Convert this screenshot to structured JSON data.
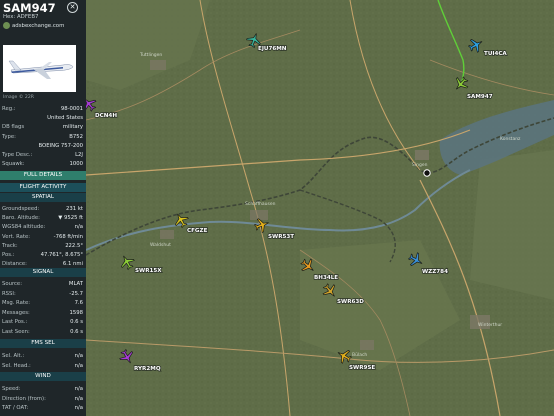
{
  "aircraft": {
    "callsign": "SAM947",
    "hex_line": "Hex:  ADFEB7",
    "source": "adsbexchange.com",
    "photo_credit": "Image © 22R",
    "fields": [
      {
        "label": "Reg.:",
        "value": "98-0001"
      },
      {
        "label": "",
        "value": "United States"
      },
      {
        "label": "DB flags",
        "value": "military"
      },
      {
        "label": "Type:",
        "value": "B752"
      },
      {
        "label": "",
        "value": "BOEING 757-200"
      },
      {
        "label": "Type Desc.:",
        "value": "L2J"
      },
      {
        "label": "Squawk:",
        "value": "1000"
      }
    ],
    "full_details": "FULL DETAILS",
    "flight_activity": "FLIGHT ACTIVITY",
    "spatial_header": "SPATIAL",
    "spatial": [
      {
        "label": "Groundspeed:",
        "value": "231 kt"
      },
      {
        "label": "Baro. Altitude:",
        "value": "▼ 9525 ft"
      },
      {
        "label": "WGS84 altitude:",
        "value": "n/a"
      },
      {
        "label": "Vert. Rate:",
        "value": "-768 ft/min"
      },
      {
        "label": "Track:",
        "value": "222.5°"
      },
      {
        "label": "Pos.:",
        "value": "47.761°, 8.675°"
      },
      {
        "label": "Distance:",
        "value": "6.1 nmi"
      }
    ],
    "signal_header": "SIGNAL",
    "signal": [
      {
        "label": "Source:",
        "value": "MLAT"
      },
      {
        "label": "RSSI:",
        "value": "-25.7"
      },
      {
        "label": "Msg. Rate:",
        "value": "7.6"
      },
      {
        "label": "Messages:",
        "value": "1598"
      },
      {
        "label": "Last Pos.:",
        "value": "0.6 s"
      },
      {
        "label": "Last Seen:",
        "value": "0.6 s"
      }
    ],
    "fms_header": "FMS SEL",
    "fms": [
      {
        "label": "Sel. Alt.:",
        "value": "n/a"
      },
      {
        "label": "Sel. Head.:",
        "value": "n/a"
      }
    ],
    "wind_header": "WIND",
    "wind": [
      {
        "label": "Speed:",
        "value": "n/a"
      },
      {
        "label": "Direction (from):",
        "value": "n/a"
      },
      {
        "label": "TAT / OAT:",
        "value": "n/a"
      }
    ]
  },
  "map": {
    "planes": [
      {
        "label": "EJU76MN",
        "color": "#37b39a"
      },
      {
        "label": "TUI4CA",
        "color": "#2ea0e0"
      },
      {
        "label": "SAM947",
        "color": "#8dcc38"
      },
      {
        "label": "DCN4H",
        "color": "#a63cd6"
      },
      {
        "label": "CFGZE",
        "color": "#d8c21c"
      },
      {
        "label": "SWR53T",
        "color": "#e3b01b"
      },
      {
        "label": "WZZ784",
        "color": "#3a90d8"
      },
      {
        "label": "BH34LE",
        "color": "#e79b22"
      },
      {
        "label": "SWR15X",
        "color": "#8dcc38"
      },
      {
        "label": "SWR63D",
        "color": "#d2a42a"
      },
      {
        "label": "RYR2MQ",
        "color": "#a63cd6"
      },
      {
        "label": "SWR9SE",
        "color": "#e3b01b"
      }
    ],
    "places": [
      "Singen",
      "Konstanz",
      "Schaffhausen",
      "Winterthur",
      "Tuttlingen",
      "Waldshut",
      "Bülach"
    ]
  }
}
